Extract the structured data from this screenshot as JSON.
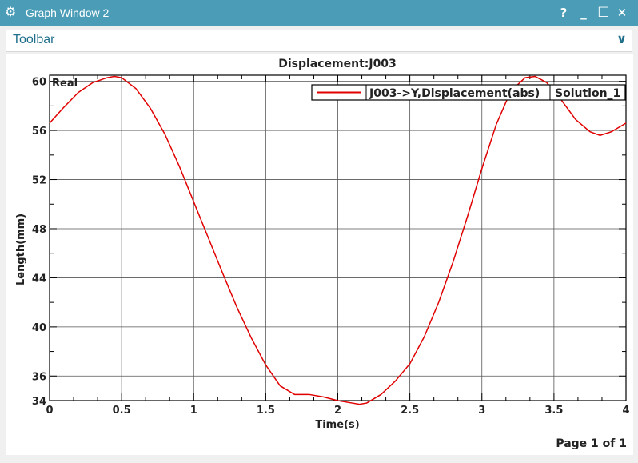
{
  "window": {
    "title": "Graph Window 2",
    "app_icon": "gear-icon",
    "help_label": "?",
    "minimize_label": "_",
    "maximize_label": "☐",
    "close_label": "✕"
  },
  "toolbar": {
    "label": "Toolbar",
    "toggle_icon": "chevron-down-icon"
  },
  "colors": {
    "titlebar": "#4b9db7",
    "series": "#e00000",
    "toolbar_text": "#1f6f8b"
  },
  "chart_data": {
    "type": "line",
    "title": "Displacement:J003",
    "xlabel": "Time(s)",
    "ylabel": "Length(mm)",
    "xlim": [
      0,
      4
    ],
    "ylim": [
      34,
      60.5
    ],
    "x_ticks": [
      0,
      0.5,
      1,
      1.5,
      2,
      2.5,
      3,
      3.5,
      4
    ],
    "x_tick_labels": [
      "0",
      "0.5",
      "1",
      "1.5",
      "2",
      "2.5",
      "3",
      "3.5",
      "4"
    ],
    "y_ticks": [
      34,
      36,
      40,
      44,
      48,
      52,
      56,
      60
    ],
    "y_tick_labels": [
      "34",
      "36",
      "40",
      "44",
      "48",
      "52",
      "56",
      "60"
    ],
    "grid": true,
    "corner_label": "Real",
    "legend": {
      "position": "top-right",
      "entries": [
        "J003->Y,Displacement(abs)"
      ],
      "tag": "Solution_1"
    },
    "series": [
      {
        "name": "J003->Y,Displacement(abs)",
        "color": "#e00000",
        "x": [
          0,
          0.1,
          0.2,
          0.3,
          0.4,
          0.45,
          0.5,
          0.6,
          0.7,
          0.8,
          0.9,
          1.0,
          1.1,
          1.2,
          1.3,
          1.4,
          1.5,
          1.6,
          1.7,
          1.8,
          1.9,
          2.0,
          2.1,
          2.15,
          2.2,
          2.3,
          2.4,
          2.5,
          2.6,
          2.7,
          2.8,
          2.9,
          3.0,
          3.1,
          3.2,
          3.3,
          3.37,
          3.45,
          3.55,
          3.65,
          3.75,
          3.82,
          3.9,
          4.0
        ],
        "y": [
          56.6,
          57.9,
          59.1,
          59.9,
          60.3,
          60.4,
          60.3,
          59.4,
          57.8,
          55.7,
          53.1,
          50.2,
          47.3,
          44.4,
          41.6,
          39.1,
          36.9,
          35.2,
          34.5,
          34.5,
          34.3,
          34.0,
          33.8,
          33.7,
          33.8,
          34.5,
          35.6,
          37.0,
          39.2,
          42.0,
          45.3,
          49.0,
          52.9,
          56.5,
          59.2,
          60.3,
          60.4,
          59.9,
          58.5,
          56.9,
          55.9,
          55.6,
          55.9,
          56.6
        ]
      }
    ]
  },
  "footer": {
    "page_label": "Page 1 of 1"
  }
}
